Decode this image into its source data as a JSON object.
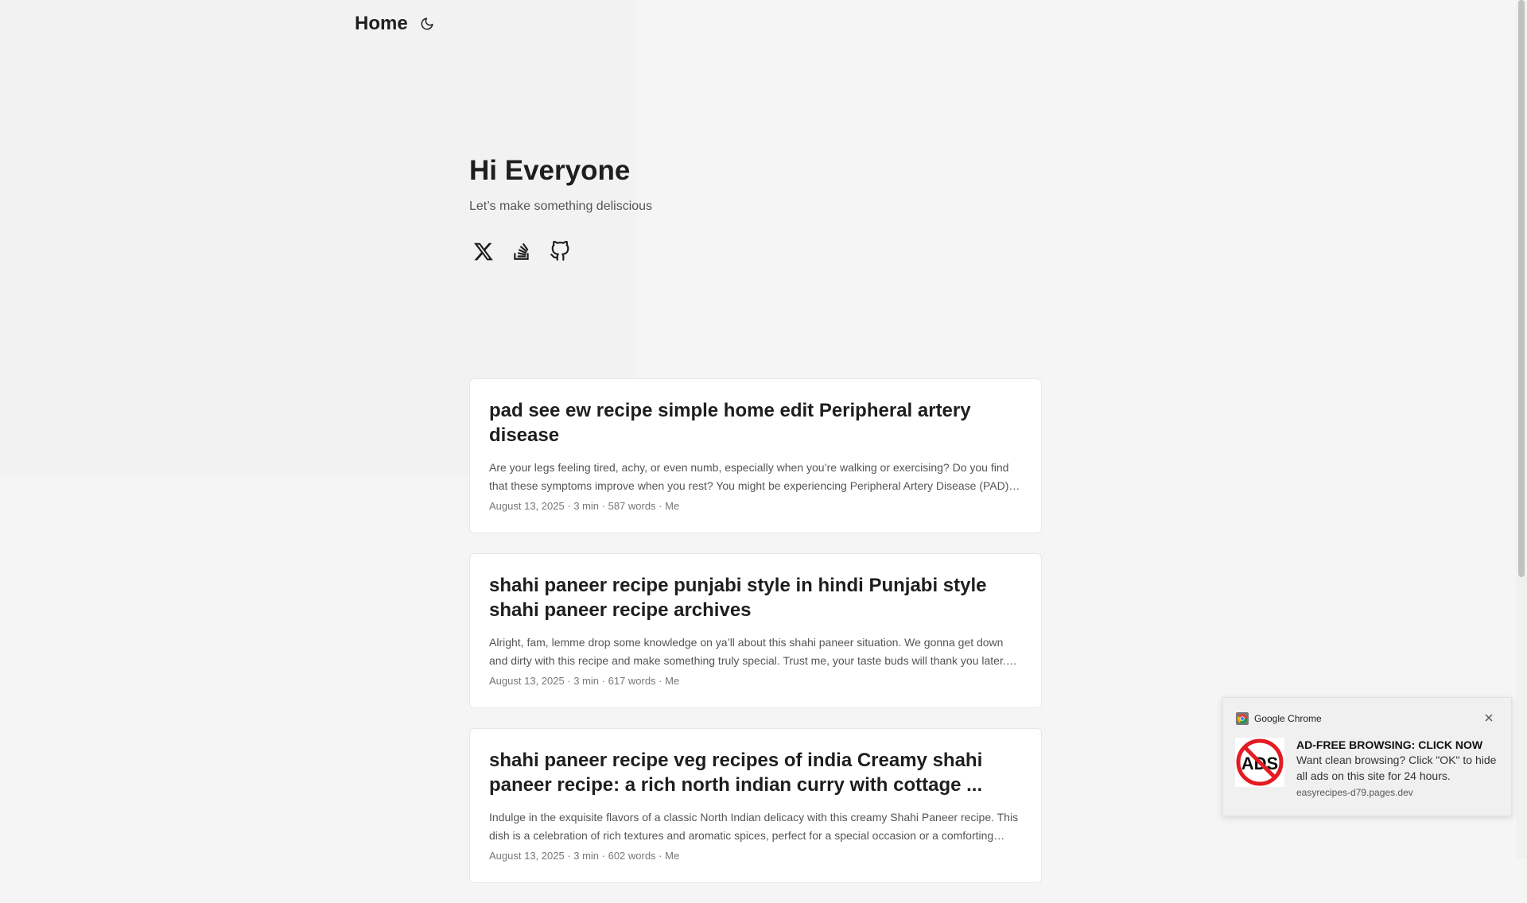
{
  "header": {
    "home_label": "Home"
  },
  "hero": {
    "title": "Hi Everyone",
    "subtitle": "Let’s make something deliscious"
  },
  "social": {
    "icons": [
      "x-icon",
      "stackoverflow-icon",
      "github-icon"
    ]
  },
  "posts": [
    {
      "title": "pad see ew recipe simple home edit Peripheral artery disease",
      "summary": "Are your legs feeling tired, achy, or even numb, especially when you’re walking or exercising? Do you find that these symptoms improve when you rest? You might be experiencing Peripheral Artery Disease (PAD). PAD is a common condition that affects millions.",
      "meta": "August 13, 2025 · 3 min · 587 words · Me"
    },
    {
      "title": "shahi paneer recipe punjabi style in hindi Punjabi style shahi paneer recipe archives",
      "summary": "Alright, fam, lemme drop some knowledge on ya’ll about this shahi paneer situation. We gonna get down and dirty with this recipe and make something truly special. Trust me, your taste buds will thank you later. Let's go.",
      "meta": "August 13, 2025 · 3 min · 617 words · Me"
    },
    {
      "title": "shahi paneer recipe veg recipes of india Creamy shahi paneer recipe: a rich north indian curry with cottage ...",
      "summary": "Indulge in the exquisite flavors of a classic North Indian delicacy with this creamy Shahi Paneer recipe. This dish is a celebration of rich textures and aromatic spices, perfect for a special occasion or a comforting meal.",
      "meta": "August 13, 2025 · 3 min · 602 words · Me"
    }
  ],
  "notification": {
    "app": "Google Chrome",
    "badge_text": "ADS",
    "title": "AD-FREE BROWSING: CLICK NOW",
    "message": "Want clean browsing? Click \"OK\" to hide all ads on this site for 24 hours.",
    "source": "easyrecipes-d79.pages.dev"
  },
  "colors": {
    "accent": "#1e1e1e",
    "ads_red": "#e31b23"
  }
}
